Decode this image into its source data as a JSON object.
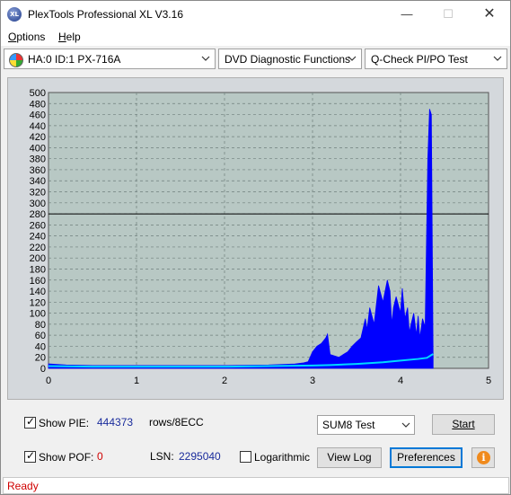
{
  "window": {
    "title": "PlexTools Professional XL V3.16",
    "icon_text": "XL"
  },
  "menu": {
    "items": [
      {
        "label": "Options",
        "underline": "O",
        "rest": "ptions"
      },
      {
        "label": "Help",
        "underline": "H",
        "rest": "elp"
      }
    ]
  },
  "toolbar": {
    "drive": "HA:0 ID:1  PX-716A",
    "function": "DVD Diagnostic Functions",
    "test": "Q-Check PI/PO Test"
  },
  "chart_data": {
    "type": "area",
    "ylim": [
      0,
      500
    ],
    "xlim": [
      0,
      5
    ],
    "y_ticks": [
      0,
      20,
      40,
      60,
      80,
      100,
      120,
      140,
      160,
      180,
      200,
      220,
      240,
      260,
      280,
      300,
      320,
      340,
      360,
      380,
      400,
      420,
      440,
      460,
      480,
      500
    ],
    "x_ticks": [
      0,
      1,
      2,
      3,
      4,
      5
    ],
    "threshold_line": 280,
    "background_color": "#b8c8c4",
    "series": [
      {
        "color": "#0000ff",
        "x": [
          0.0,
          0.2,
          0.5,
          1.0,
          1.5,
          2.0,
          2.5,
          2.8,
          2.9,
          2.95,
          3.0,
          3.05,
          3.1,
          3.15,
          3.17,
          3.2,
          3.3,
          3.35,
          3.4,
          3.45,
          3.5,
          3.55,
          3.6,
          3.62,
          3.65,
          3.7,
          3.75,
          3.8,
          3.85,
          3.88,
          3.9,
          3.92,
          3.95,
          4.0,
          4.02,
          4.05,
          4.08,
          4.1,
          4.12,
          4.15,
          4.18,
          4.2,
          4.22,
          4.25,
          4.28,
          4.3,
          4.31,
          4.33,
          4.35,
          4.37
        ],
        "y": [
          8,
          6,
          5,
          5,
          5,
          5,
          6,
          8,
          10,
          12,
          30,
          40,
          45,
          55,
          62,
          25,
          20,
          25,
          30,
          40,
          48,
          55,
          90,
          70,
          110,
          80,
          150,
          120,
          160,
          140,
          80,
          110,
          130,
          100,
          145,
          90,
          110,
          65,
          80,
          100,
          60,
          95,
          55,
          90,
          75,
          280,
          380,
          470,
          460,
          20
        ]
      },
      {
        "color": "#00d8ff",
        "x": [
          0,
          0.5,
          1,
          1.5,
          2,
          2.5,
          3,
          3.2,
          3.5,
          3.8,
          4,
          4.2,
          4.3,
          4.35,
          4.37
        ],
        "y": [
          4,
          3,
          3,
          3,
          3,
          4,
          5,
          6,
          8,
          11,
          14,
          17,
          19,
          24,
          26
        ]
      }
    ]
  },
  "controls": {
    "show_pie_label": "Show PIE:",
    "pie_value": "444373",
    "rows_label": "rows/8ECC",
    "show_pof_label": "Show POF:",
    "pof_value": "0",
    "lsn_label": "LSN:",
    "lsn_value": "2295040",
    "log_label": "Logarithmic",
    "test_select": "SUM8 Test",
    "start_label": "Start",
    "view_log_label": "View Log",
    "preferences_label": "Preferences",
    "info_glyph": "i"
  },
  "status": {
    "text": "Ready"
  }
}
